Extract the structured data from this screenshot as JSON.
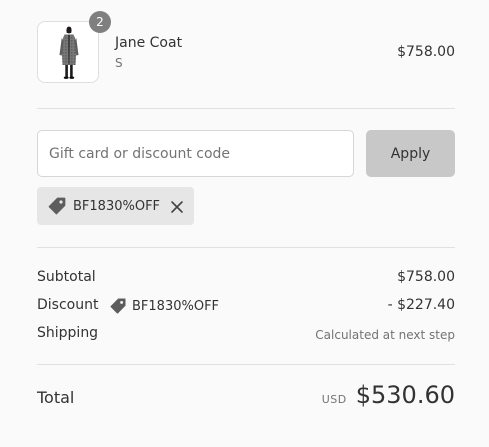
{
  "product": {
    "name": "Jane Coat",
    "variant": "S",
    "price": "$758.00",
    "quantity": "2",
    "image_icon": "coat-model-photo"
  },
  "discount_form": {
    "placeholder": "Gift card or discount code",
    "value": "",
    "apply_label": "Apply",
    "applied_code": "BF1830%OFF",
    "tag_icon": "tag-icon",
    "remove_icon": "close-icon"
  },
  "summary": {
    "subtotal_label": "Subtotal",
    "subtotal_value": "$758.00",
    "discount_label": "Discount",
    "discount_code": "BF1830%OFF",
    "discount_value": "- $227.40",
    "shipping_label": "Shipping",
    "shipping_value": "Calculated at next step"
  },
  "total": {
    "label": "Total",
    "currency": "USD",
    "amount": "$530.60"
  },
  "colors": {
    "background": "#fafafa",
    "apply_button": "#c8c8c8",
    "chip_background": "#e6e6e6",
    "badge": "#7f7f7f",
    "muted_text": "#737373",
    "divider": "#e1e1e1"
  }
}
